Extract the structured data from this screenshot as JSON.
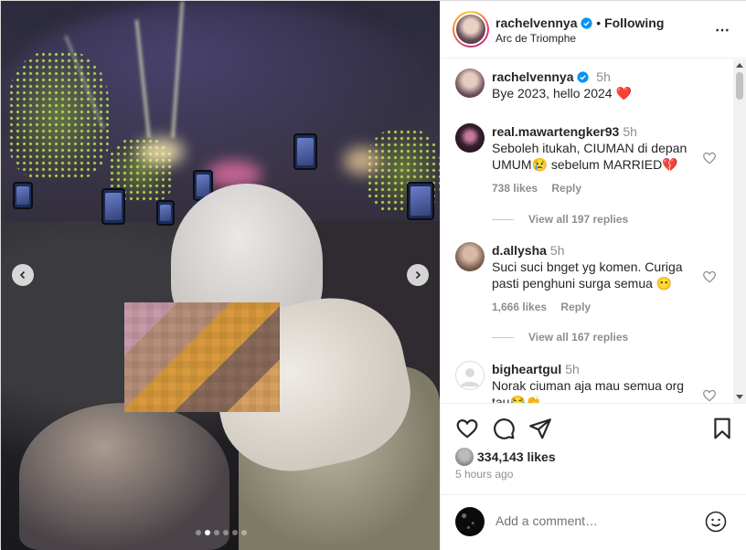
{
  "post": {
    "username": "rachelvennya",
    "separator": "•",
    "follow_status": "Following",
    "location": "Arc de Triomphe",
    "more_icon": "⋯",
    "carousel_dots": 6,
    "carousel_active": 1
  },
  "caption": {
    "username": "rachelvennya",
    "time": "5h",
    "text": "Bye 2023, hello 2024 ❤️"
  },
  "comments": [
    {
      "username": "real.mawartengker93",
      "time": "5h",
      "text": "Seboleh itukah, CIUMAN di depan UMUM😢 sebelum MARRIED💔",
      "likes": "738 likes",
      "reply": "Reply",
      "view_replies": "View all 197 replies"
    },
    {
      "username": "d.allysha",
      "time": "5h",
      "text": "Suci suci bnget yg komen. Curiga pasti penghuni surga semua 😶",
      "likes": "1,666 likes",
      "reply": "Reply",
      "view_replies": "View all 167 replies"
    },
    {
      "username": "bigheartgul",
      "time": "5h",
      "text": "Norak ciuman aja mau semua org tau😂👏"
    }
  ],
  "footer": {
    "likes": "334,143 likes",
    "time_ago": "5 hours ago",
    "comment_placeholder": "Add a comment…"
  },
  "colors": {
    "verified": "#0095f6",
    "broken_heart": "#ed4956",
    "muted": "#8e8e8e"
  }
}
